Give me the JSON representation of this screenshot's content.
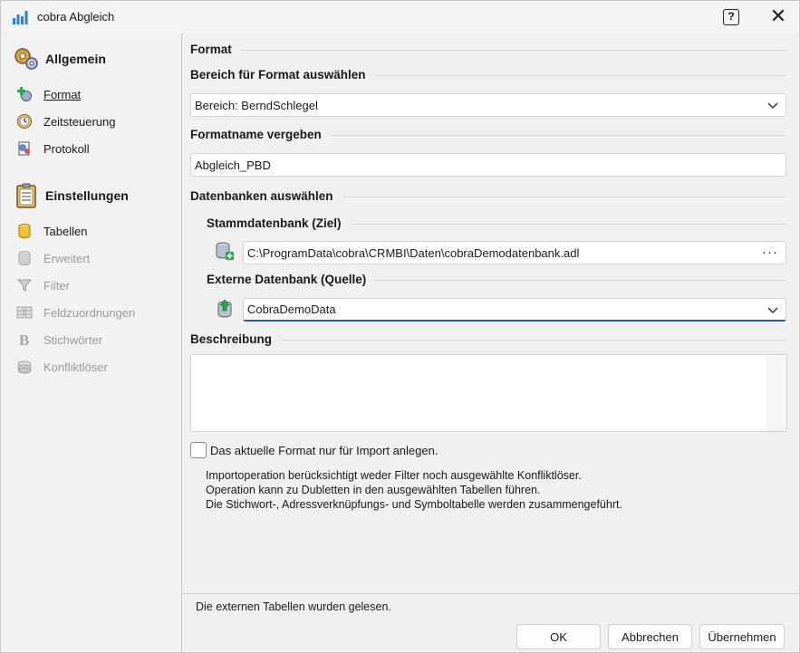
{
  "window": {
    "title": "cobra Abgleich",
    "help_label": "?",
    "close_label": "✕"
  },
  "sidebar": {
    "section1": {
      "label": "Allgemein",
      "icon": "gears-icon"
    },
    "items1": [
      {
        "label": "Format",
        "icon": "plus-gear-icon",
        "active": true
      },
      {
        "label": "Zeitsteuerung",
        "icon": "clock-icon"
      },
      {
        "label": "Protokoll",
        "icon": "log-icon"
      }
    ],
    "section2": {
      "label": "Einstellungen",
      "icon": "clipboard-icon"
    },
    "items2": [
      {
        "label": "Tabellen",
        "icon": "database-icon",
        "enabled": true
      },
      {
        "label": "Erweitert",
        "icon": "database-gray-icon",
        "enabled": false
      },
      {
        "label": "Filter",
        "icon": "filter-icon",
        "enabled": false
      },
      {
        "label": "Feldzuordnungen",
        "icon": "field-mapping-icon",
        "enabled": false
      },
      {
        "label": "Stichwörter",
        "icon": "bold-b-icon",
        "enabled": false
      },
      {
        "label": "Konfliktlöser",
        "icon": "stack-icon",
        "enabled": false
      }
    ]
  },
  "main": {
    "format_header": "Format",
    "bereich_header": "Bereich für Format auswählen",
    "bereich_value": "Bereich: BerndSchlegel",
    "formatname_header": "Formatname vergeben",
    "formatname_value": "Abgleich_PBD",
    "datenbanken_header": "Datenbanken auswählen",
    "stamm_header": "Stammdatenbank (Ziel)",
    "stamm_value": "C:\\ProgramData\\cobra\\CRMBI\\Daten\\cobraDemodatenbank.adl",
    "stamm_button": "···",
    "extern_header": "Externe Datenbank (Quelle)",
    "extern_value": "CobraDemoData",
    "beschreibung_header": "Beschreibung",
    "beschreibung_value": "",
    "checkbox_label": "Das aktuelle Format nur für Import anlegen.",
    "checkbox_checked": false,
    "info_lines": [
      "Importoperation berücksichtigt weder Filter noch ausgewählte Konfliktlöser.",
      "Operation kann zu Dubletten in den ausgewählten Tabellen führen.",
      "Die Stichwort-, Adressverknüpfungs- und Symboltabelle werden zusammengeführt."
    ]
  },
  "status": {
    "text": "Die externen Tabellen wurden gelesen."
  },
  "buttons": {
    "ok": "OK",
    "cancel": "Abbrechen",
    "apply": "Übernehmen"
  },
  "colors": {
    "accent": "#1f5fa8",
    "background": "#f0f0f0"
  }
}
